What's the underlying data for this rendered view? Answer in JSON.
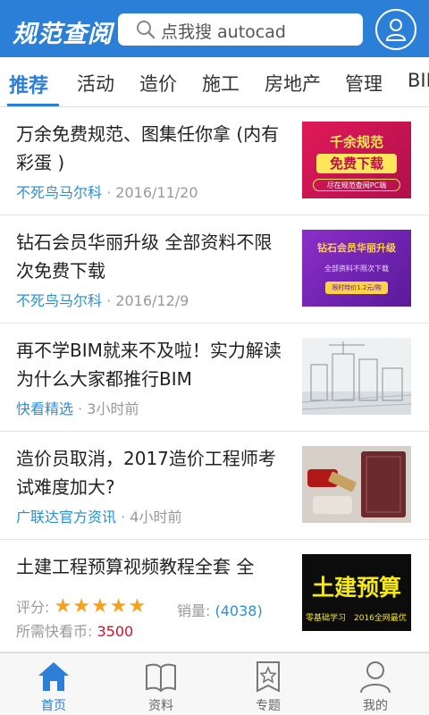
{
  "header": {
    "logo": "规范查阅",
    "search_placeholder": "点我搜 autocad",
    "search_icon": "search-icon",
    "avatar_icon": "user-icon"
  },
  "tabs": [
    "推荐",
    "活动",
    "造价",
    "施工",
    "房地产",
    "管理",
    "BIM"
  ],
  "active_tab": "推荐",
  "articles": [
    {
      "title": "万余免费规范、图集任你拿 (内有彩蛋 )",
      "author": "不死鸟马尔科",
      "time": "2016/11/20",
      "thumb": {
        "line1": "千余规范",
        "line2": "免费下载",
        "line3": "尽在规范查阅PC端"
      }
    },
    {
      "title": "钻石会员华丽升级 全部资料不限次免费下载",
      "author": "不死鸟马尔科",
      "time": "2016/12/9",
      "thumb": {
        "line1": "钻石会员华丽升级",
        "line2": "全部资料不限次下载",
        "line3": "限时特价1.2元/购"
      }
    },
    {
      "title": "再不学BIM就来不及啦！实力解读为什么大家都推行BIM",
      "author": "快看精选",
      "time": "3小时前"
    },
    {
      "title": "造价员取消，2017造价工程师考试难度加大?",
      "author": "广联达官方资讯",
      "time": "4小时前"
    }
  ],
  "product": {
    "title": "土建工程预算视频教程全套 全",
    "rating_label": "评分:",
    "stars": 5,
    "sales_label": "销量:",
    "sales_value": "(4038)",
    "price_label": "所需快看币:",
    "price_value": "3500",
    "thumb": {
      "main": "土建预算",
      "sub_left": "零基础学习",
      "sub_right": "2016全网最优"
    }
  },
  "bottom_nav": [
    {
      "label": "首页",
      "icon": "home-icon",
      "active": true
    },
    {
      "label": "资料",
      "icon": "book-icon",
      "active": false
    },
    {
      "label": "专题",
      "icon": "topic-icon",
      "active": false
    },
    {
      "label": "我的",
      "icon": "profile-icon",
      "active": false
    }
  ],
  "colors": {
    "brand": "#2b7fd6",
    "link": "#2b8fd8",
    "price": "#d0102c",
    "star": "#f6a21e"
  }
}
